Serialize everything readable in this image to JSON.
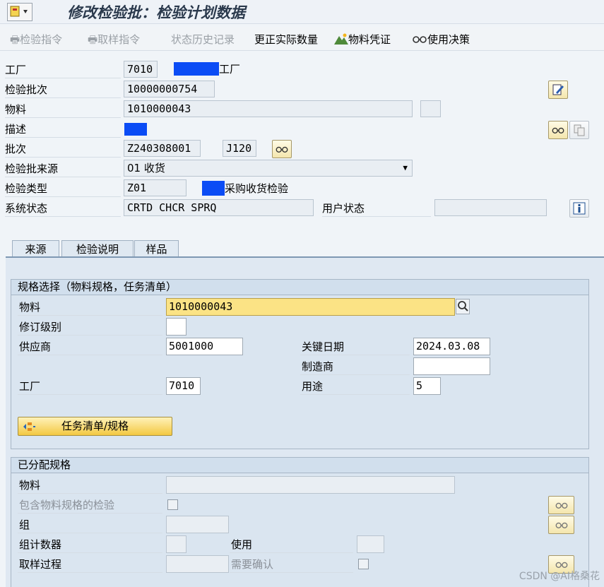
{
  "window": {
    "title": "修改检验批：检验计划数据"
  },
  "toolbar": {
    "inspection_instruction": "检验指令",
    "sampling_instruction": "取样指令",
    "status_history": "状态历史记录",
    "correct_actual_qty": "更正实际数量",
    "material_document": "物料凭证",
    "usage_decision": "使用决策"
  },
  "header": {
    "plant_label": "工厂",
    "plant_value": "7010",
    "plant_name_suffix": "工厂",
    "lot_label": "检验批次",
    "lot_value": "10000000754",
    "material_label": "物料",
    "material_value": "1010000043",
    "desc_label": "描述",
    "batch_label": "批次",
    "batch_value": "Z240308001",
    "batch_extra": "J120",
    "origin_label": "检验批来源",
    "origin_value": "01 收货",
    "type_label": "检验类型",
    "type_value": "Z01",
    "type_desc_suffix": "采购收货检验",
    "sys_status_label": "系统状态",
    "sys_status_value": "CRTD CHCR SPRQ",
    "user_status_label": "用户状态"
  },
  "tabs": {
    "source": "来源",
    "insp_spec": "检验说明",
    "sample": "样品"
  },
  "spec_select": {
    "title": "规格选择（物料规格，任务清单）",
    "material_label": "物料",
    "material_value": "1010000043",
    "revision_label": "修订级别",
    "vendor_label": "供应商",
    "vendor_value": "5001000",
    "key_date_label": "关键日期",
    "key_date_value": "2024.03.08",
    "manufacturer_label": "制造商",
    "plant_label": "工厂",
    "plant_value": "7010",
    "usage_label": "用途",
    "usage_value": "5",
    "tasklist_button": "任务清单/规格"
  },
  "assigned_spec": {
    "title": "已分配规格",
    "material_label": "物料",
    "incl_material_spec_label": "包含物料规格的检验",
    "group_label": "组",
    "group_counter_label": "组计数器",
    "usage_label": "使用",
    "sampling_proc_label": "取样过程",
    "confirm_label": "需要确认"
  },
  "watermark": "CSDN @AI格桑花"
}
